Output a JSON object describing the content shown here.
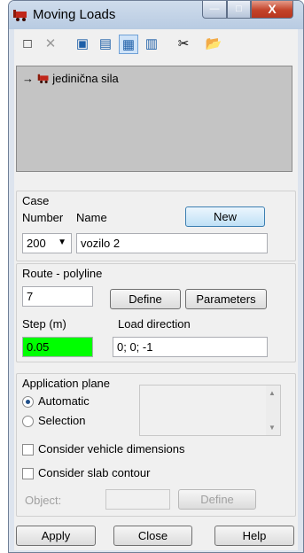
{
  "window": {
    "title": "Moving Loads",
    "controls": {
      "minimize": "—",
      "maximize": "□",
      "close": "X"
    }
  },
  "toolbar": {
    "buttons": [
      {
        "name": "new-doc-icon",
        "glyph": "□"
      },
      {
        "name": "delete-icon",
        "glyph": "✕"
      },
      {
        "name": "view-small-icon",
        "glyph": "▣"
      },
      {
        "name": "view-list-icon",
        "glyph": "▤"
      },
      {
        "name": "view-details-icon",
        "glyph": "▦"
      },
      {
        "name": "view-table-icon",
        "glyph": "▥"
      },
      {
        "name": "cut-icon",
        "glyph": "✂"
      },
      {
        "name": "open-folder-icon",
        "glyph": "📂"
      }
    ]
  },
  "tree": {
    "items": [
      {
        "label": "jedinična sila",
        "selected_arrow": "→"
      }
    ]
  },
  "case": {
    "group_label": "Case",
    "number_label": "Number",
    "name_label": "Name",
    "new_button": "New",
    "number_value": "200",
    "name_value": "vozilo 2"
  },
  "route": {
    "group_label": "Route - polyline",
    "polyline_value": "7",
    "define_button": "Define",
    "parameters_button": "Parameters",
    "step_label": "Step (m)",
    "step_value": "0.05",
    "load_direction_label": "Load direction",
    "load_direction_value": "0; 0; -1"
  },
  "plane": {
    "group_label": "Application plane",
    "automatic_label": "Automatic",
    "selection_label": "Selection",
    "selected": "Automatic",
    "vehicle_dimensions_label": "Consider vehicle dimensions",
    "slab_contour_label": "Consider slab contour",
    "object_label": "Object:",
    "object_value": "",
    "define_button": "Define"
  },
  "footer": {
    "apply": "Apply",
    "close": "Close",
    "help": "Help"
  },
  "colors": {
    "step_highlight": "#00ff00",
    "tree_background": "#c4c4c4"
  }
}
